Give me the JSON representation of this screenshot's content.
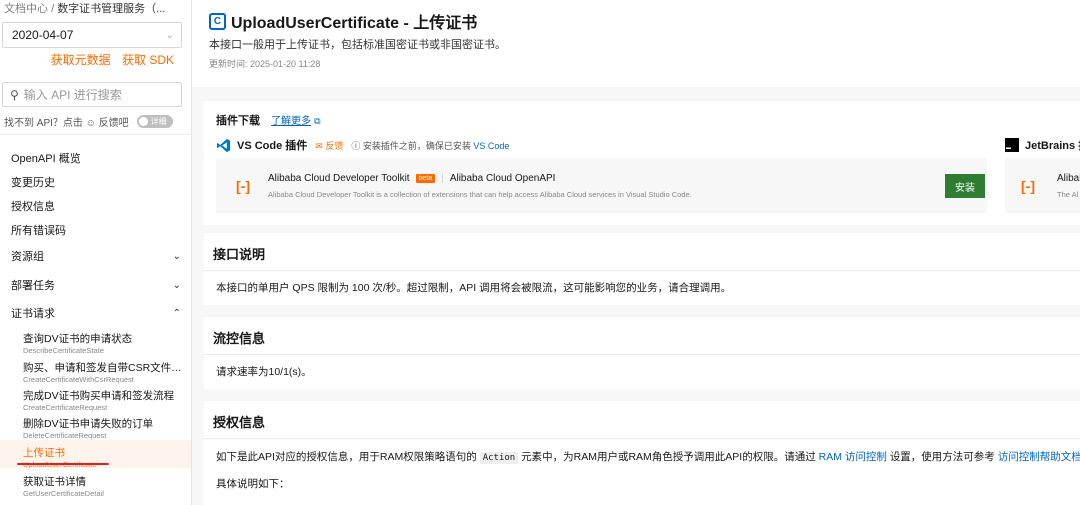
{
  "breadcrumb": {
    "root": "文档中心",
    "sep": "/",
    "current": "数字证书管理服务（..."
  },
  "date_select": {
    "value": "2020-04-07"
  },
  "side_links": {
    "metadata": "获取元数据",
    "sdk": "获取 SDK"
  },
  "search": {
    "placeholder": "输入 API 进行搜索"
  },
  "not_found": {
    "text": "找不到 API？点击 ☺ 反馈吧",
    "toggle_label": "详细"
  },
  "nav": {
    "items": [
      {
        "label": "OpenAPI 概览"
      },
      {
        "label": "变更历史"
      },
      {
        "label": "授权信息"
      },
      {
        "label": "所有错误码"
      },
      {
        "label": "资源组",
        "arrow": "⌄"
      },
      {
        "label": "部署任务",
        "arrow": "⌄"
      },
      {
        "label": "证书请求",
        "arrow": "⌃"
      }
    ],
    "subitems": [
      {
        "cn": "查询DV证书的申请状态",
        "en": "DescribeCertificateState"
      },
      {
        "cn": "购买、申请和签发自带CSR文件的DV...",
        "en": "CreateCertificateWithCsrRequest"
      },
      {
        "cn": "完成DV证书购买申请和签发流程",
        "en": "CreateCertificateRequest"
      },
      {
        "cn": "删除DV证书申请失败的订单",
        "en": "DeleteCertificateRequest"
      },
      {
        "cn": "上传证书",
        "en": "UploadUserCertificate"
      },
      {
        "cn": "获取证书详情",
        "en": "GetUserCertificateDetail"
      }
    ]
  },
  "header": {
    "title": "UploadUserCertificate - 上传证书",
    "description": "本接口一般用于上传证书，包括标准国密证书或非国密证书。",
    "updated": "更新时间: 2025-01-20 11:28"
  },
  "plugin": {
    "heading": "插件下载",
    "learn_more": "了解更多",
    "vscode": {
      "name": "VS Code 插件",
      "feedback": "反馈",
      "tip_prefix": "ⓘ 安装插件之前，确保已安装",
      "tip_link": "VS Code",
      "toolkit_name": "Alibaba Cloud Developer Toolkit",
      "badge": "beta",
      "toolkit_sub": "Alibaba Cloud OpenAPI",
      "toolkit_desc": "Alibaba Cloud Developer Toolkit is a collection of extensions that can help access Alibaba Cloud services in Visual Studio Code.",
      "install": "安装"
    },
    "jetbrains": {
      "name": "JetBrains 插",
      "card_title": "Alibab",
      "card_desc": "The Al"
    }
  },
  "sections": {
    "interface": {
      "title": "接口说明",
      "text": "本接口的单用户 QPS 限制为 100 次/秒。超过限制，API 调用将会被限流，这可能影响您的业务，请合理调用。"
    },
    "flow": {
      "title": "流控信息",
      "text": "请求速率为10/1(s)。"
    },
    "auth": {
      "title": "授权信息",
      "text_a": "如下是此API对应的授权信息，用于RAM权限策略语句的",
      "code": "Action",
      "text_b": "元素中，为RAM用户或RAM角色授予调用此API的权限。请通过",
      "link1": "RAM 访问控制",
      "text_c": "设置，使用方法可参考",
      "link2": "访问控制帮助文档",
      "text_d": "。",
      "text2": "具体说明如下："
    }
  },
  "colors": {
    "accent": "#ff6a00",
    "link": "#0064c8",
    "install": "#2e7d32",
    "annotation": "#e02020"
  }
}
